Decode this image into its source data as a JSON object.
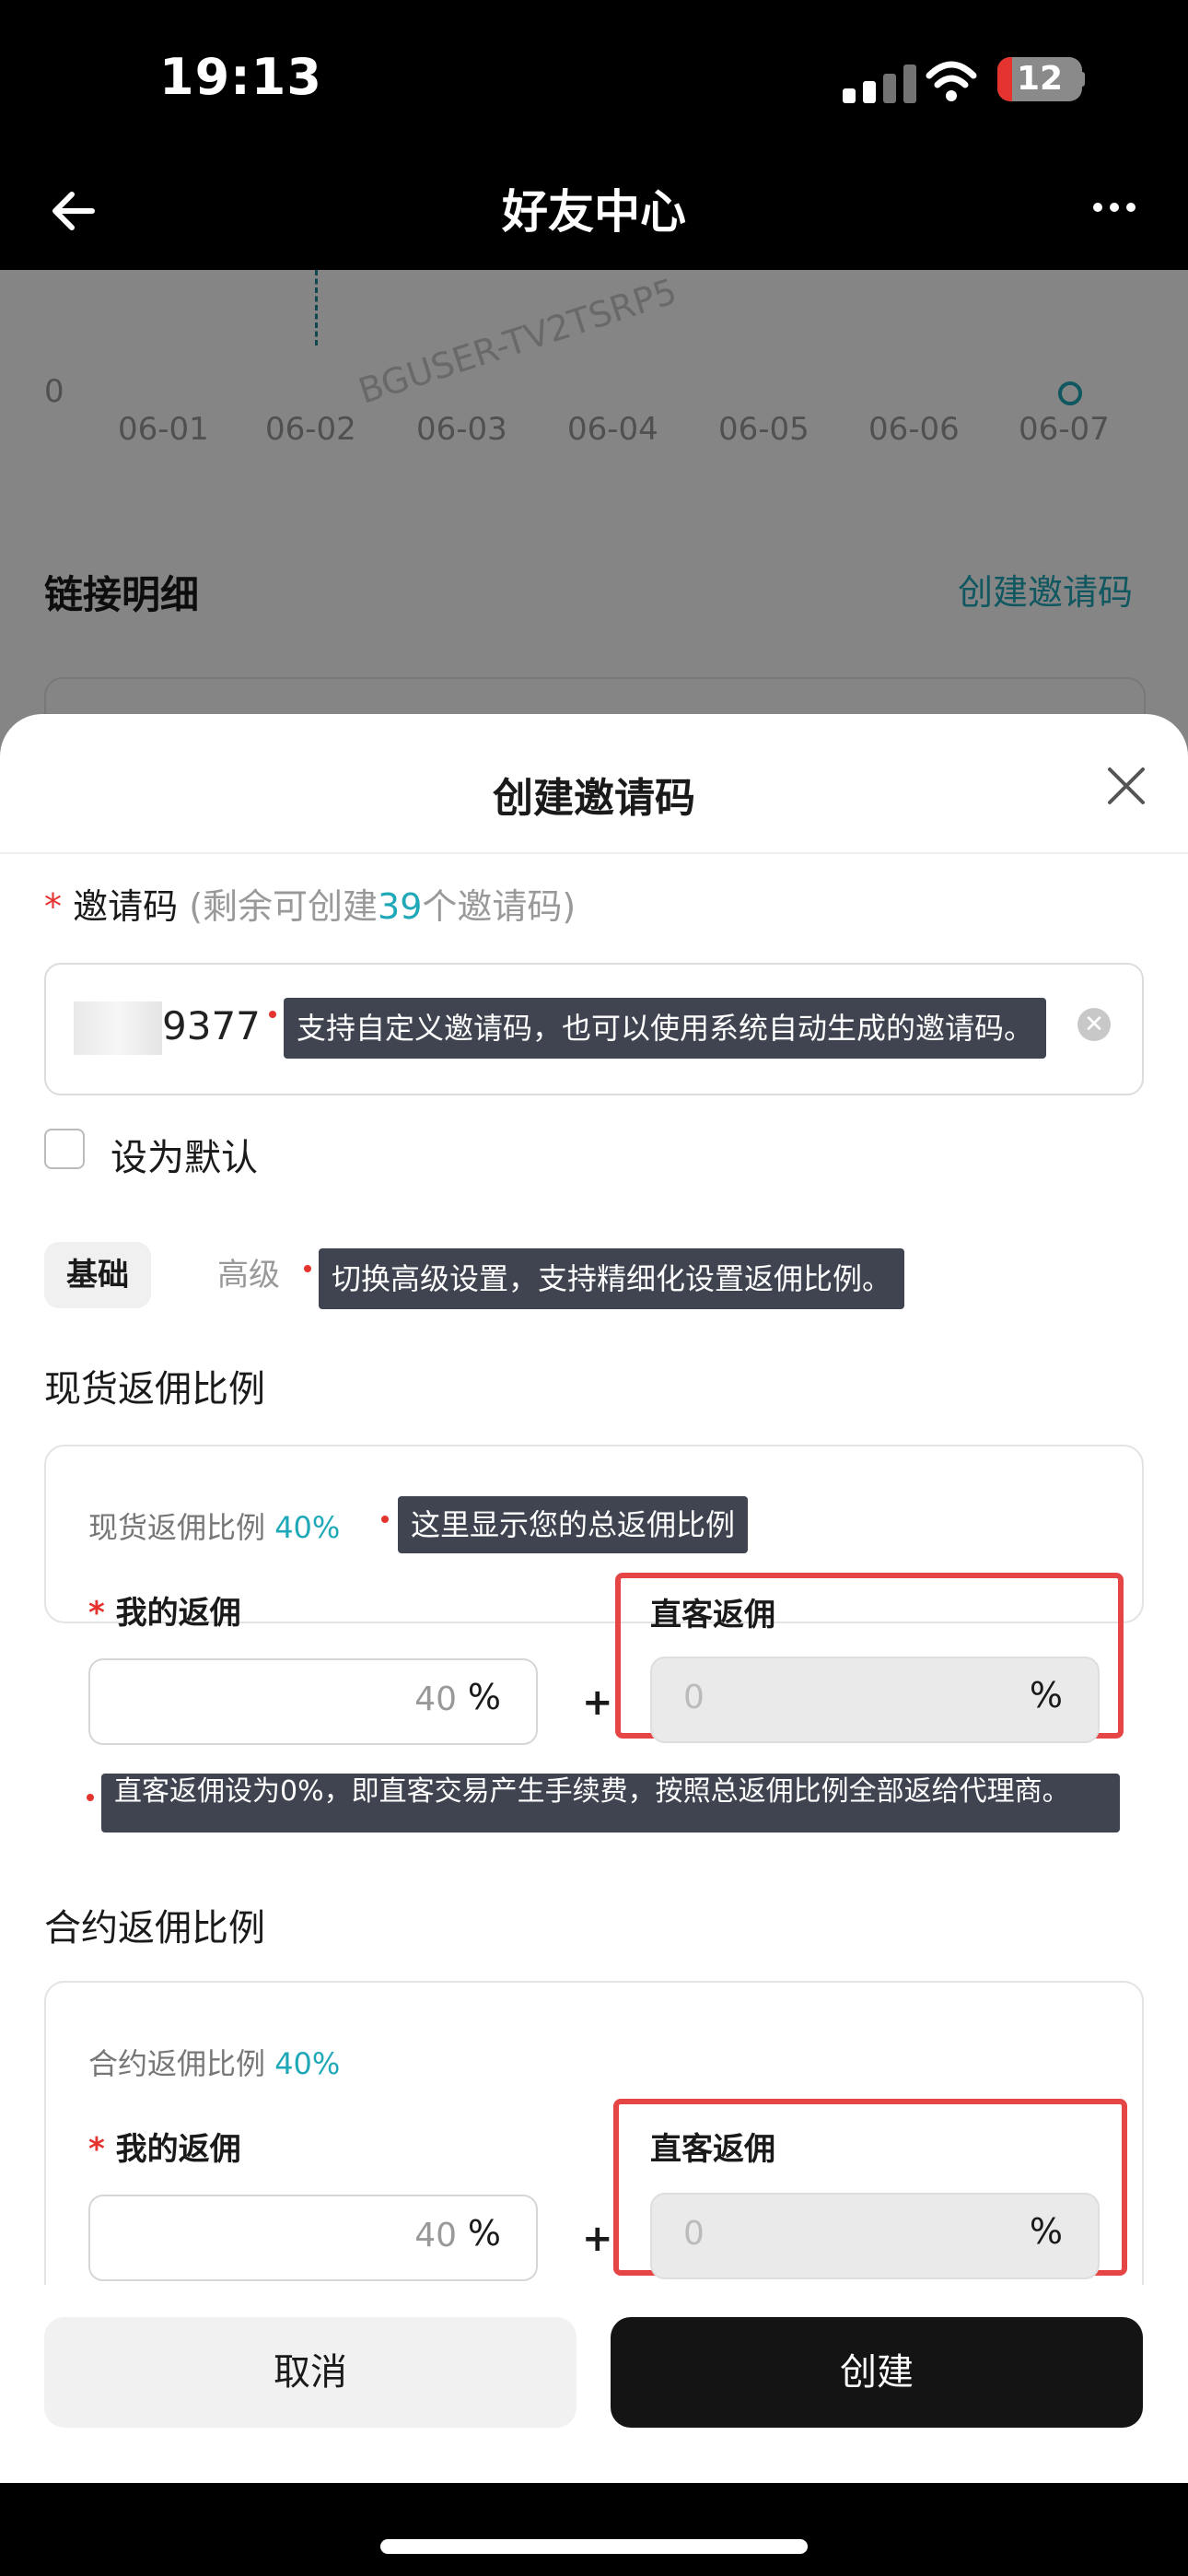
{
  "status_bar": {
    "time": "19:13",
    "battery": "12"
  },
  "nav": {
    "title": "好友中心"
  },
  "chart_bg": {
    "y_tick": "0",
    "dates": [
      "06-01",
      "06-02",
      "06-03",
      "06-04",
      "06-05",
      "06-06",
      "06-07"
    ],
    "watermark": "BGUSER-TV2TSRP5"
  },
  "link_section": {
    "title": "链接明细",
    "create_link": "创建邀请码"
  },
  "sheet": {
    "title": "创建邀请码",
    "code_label": {
      "required": "*",
      "name": "邀请码",
      "remain_prefix": " (剩余可创建",
      "remain_count": "39",
      "remain_suffix": "个邀请码)"
    },
    "code_value": "9377",
    "code_tip": "支持自定义邀请码，也可以使用系统自动生成的邀请码。",
    "default_label": "设为默认",
    "tabs": {
      "basic": "基础",
      "advanced": "高级"
    },
    "tab_tip": "切换高级设置，支持精细化设置返佣比例。",
    "spot": {
      "title": "现货返佣比例",
      "rate_label": "现货返佣比例",
      "rate_value": "40%",
      "rate_tip": "这里显示您的总返佣比例",
      "my_label": "我的返佣",
      "my_value": "40",
      "direct_label": "直客返佣",
      "direct_value": "0",
      "unit": "%",
      "plus": "+",
      "note_tip": "直客返佣设为0%，即直客交易产生手续费，按照总返佣比例全部返给代理商。"
    },
    "contract": {
      "title": "合约返佣比例",
      "rate_label": "合约返佣比例",
      "rate_value": "40%",
      "my_label": "我的返佣",
      "my_value": "40",
      "direct_label": "直客返佣",
      "direct_value": "0",
      "unit": "%",
      "plus": "+"
    },
    "buttons": {
      "cancel": "取消",
      "create": "创建"
    }
  }
}
